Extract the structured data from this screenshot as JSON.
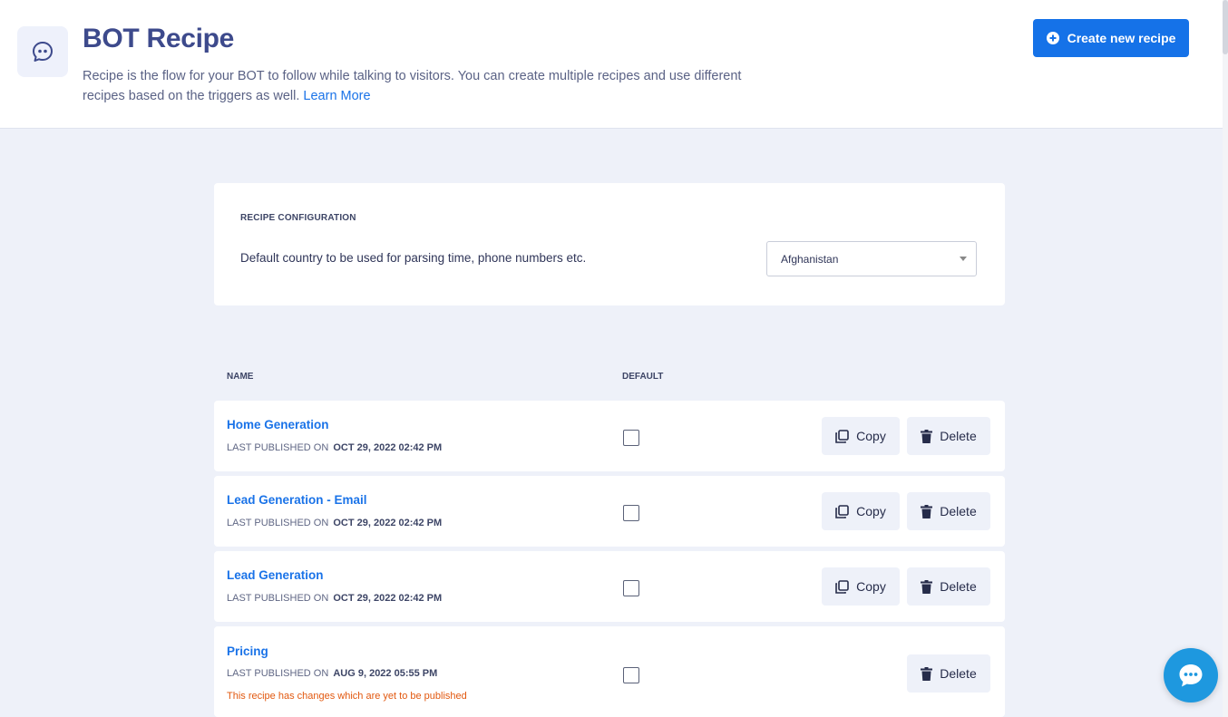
{
  "header": {
    "title": "BOT Recipe",
    "description": "Recipe is the flow for your BOT to follow while talking to visitors. You can create multiple recipes and use different recipes based on the triggers as well.",
    "learn_more": "Learn More",
    "create_button": "Create new recipe",
    "logo_icon": "chat-bubble-icon"
  },
  "config": {
    "title": "RECIPE CONFIGURATION",
    "label": "Default country to be used for parsing time, phone numbers etc.",
    "country": "Afghanistan"
  },
  "table": {
    "col_name": "NAME",
    "col_default": "DEFAULT",
    "meta_prefix": "LAST PUBLISHED ON",
    "copy_label": "Copy",
    "delete_label": "Delete",
    "rows": [
      {
        "name": "Home Generation",
        "published": "OCT 29, 2022 02:42 PM"
      },
      {
        "name": "Lead Generation - Email",
        "published": "OCT 29, 2022 02:42 PM"
      },
      {
        "name": "Lead Generation",
        "published": "OCT 29, 2022 02:42 PM"
      },
      {
        "name": "Pricing",
        "published": "AUG 9, 2022 05:55 PM",
        "warning": "This recipe has changes which are yet to be published"
      }
    ]
  },
  "colors": {
    "accent": "#1572e8",
    "title": "#3d4a8c",
    "warning": "#e2580f",
    "background": "#eef1f9",
    "chat_bubble": "#1e98df"
  }
}
